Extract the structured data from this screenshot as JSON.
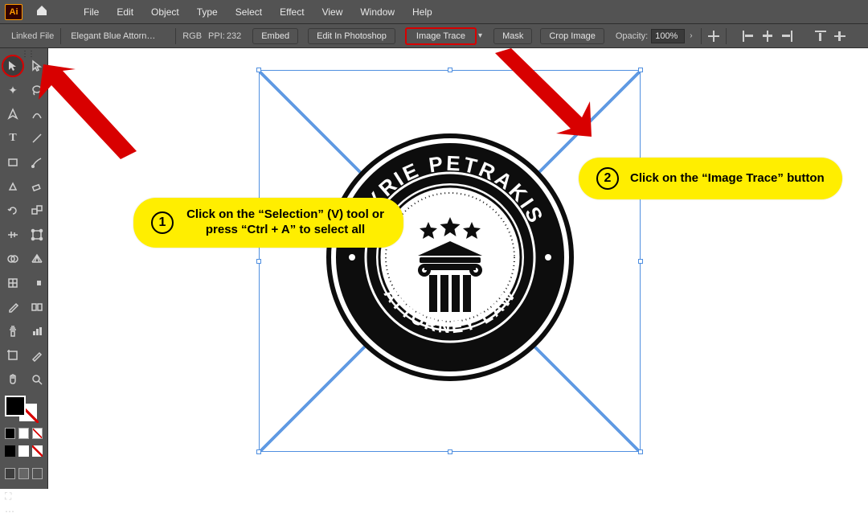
{
  "menu": [
    "File",
    "Edit",
    "Object",
    "Type",
    "Select",
    "Effect",
    "View",
    "Window",
    "Help"
  ],
  "app_logo": "Ai",
  "controlbar": {
    "linked_label": "Linked File",
    "filename": "Elegant Blue Attorney L…",
    "color_mode": "RGB",
    "ppi_label": "PPI:",
    "ppi_value": "232",
    "embed": "Embed",
    "edit_ps": "Edit In Photoshop",
    "image_trace": "Image Trace",
    "mask": "Mask",
    "crop": "Crop Image",
    "opacity_label": "Opacity:",
    "opacity_value": "100%"
  },
  "logo": {
    "top_text": "KYRIE PETRAKIS",
    "bottom_text": "ATTORNEY LAW"
  },
  "callouts": {
    "c1_num": "1",
    "c1_text": "Click on the “Selection” (V) tool or press “Ctrl + A” to select all",
    "c2_num": "2",
    "c2_text": "Click on the “Image Trace” button"
  }
}
